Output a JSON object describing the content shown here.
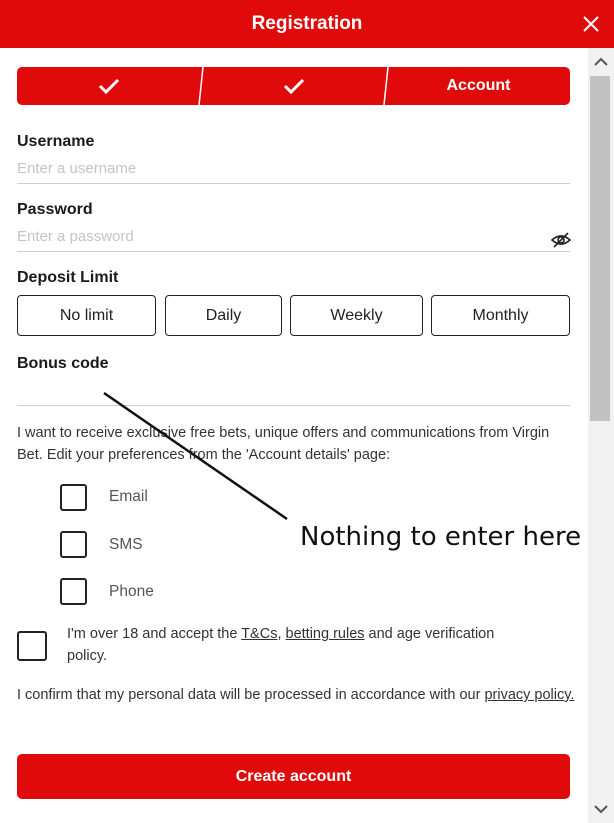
{
  "header": {
    "title": "Registration"
  },
  "steps": {
    "account_label": "Account"
  },
  "username": {
    "label": "Username",
    "placeholder": "Enter a username",
    "value": ""
  },
  "password": {
    "label": "Password",
    "placeholder": "Enter a password",
    "value": ""
  },
  "deposit_limit": {
    "label": "Deposit Limit",
    "options": [
      "No limit",
      "Daily",
      "Weekly",
      "Monthly"
    ]
  },
  "bonus_code": {
    "label": "Bonus code",
    "value": ""
  },
  "marketing": {
    "text": "I want to receive exclusive free bets, unique offers and communications from Virgin Bet. Edit your preferences from the 'Account details' page:",
    "options": [
      "Email",
      "SMS",
      "Phone"
    ]
  },
  "age_terms": {
    "text_1": "I'm over 18 and accept the ",
    "tcs_link": "T&Cs",
    "comma": ", ",
    "betting_rules_link": "betting rules",
    "text_2": " and age verification policy."
  },
  "privacy": {
    "text": "I confirm that my personal data will be processed in accordance with our ",
    "link": "privacy policy."
  },
  "create_button": "Create account",
  "annotation": "Nothing to enter here",
  "colors": {
    "brand_red": "#e10a0a"
  },
  "icons": [
    "close-icon",
    "checkmark-icon",
    "eye-slash-icon",
    "scroll-up-icon",
    "scroll-down-icon"
  ]
}
